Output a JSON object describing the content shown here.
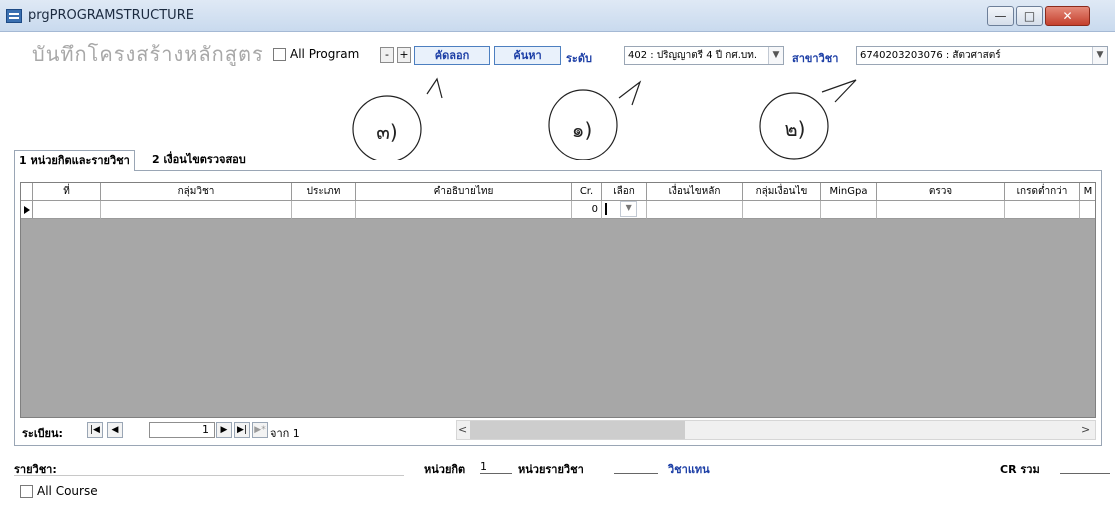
{
  "window": {
    "title": "prgPROGRAMSTRUCTURE",
    "controls": {
      "minimize": "—",
      "maximize": "□",
      "close": "✕"
    }
  },
  "toolbar": {
    "heading": "บันทึกโครงสร้างหลักสูตร",
    "all_program_label": "All Program",
    "minus_label": "-",
    "plus_label": "+",
    "copy_label": "คัดลอก",
    "search_label": "ค้นหา",
    "level_label": "ระดับ",
    "level_value": "402 : ปริญญาตรี 4 ปี กศ.บท.",
    "major_label": "สาขาวิชา",
    "major_value": "6740203203076 : สัตวศาสตร์"
  },
  "annotations": {
    "copy": "๓)",
    "level": "๑)",
    "major": "๒)"
  },
  "tabs": [
    {
      "label": "1 หน่วยกิตและรายวิชา"
    },
    {
      "label": "2 เงื่อนไขตรวจสอบ"
    }
  ],
  "grid": {
    "columns": [
      "ที่",
      "กลุ่มวิชา",
      "ประเภท",
      "คำอธิบายไทย",
      "Cr.",
      "เลือก",
      "เงื่อนไขหลัก",
      "กลุ่มเงื่อนไข",
      "MinGpa",
      "ตรวจ",
      "เกรดต่ำกว่า",
      "M"
    ],
    "row": {
      "cr": "0"
    }
  },
  "record_nav": {
    "label": "ระเบียน:",
    "current": "1",
    "of_label": "จาก 1"
  },
  "footer": {
    "subject_label": "รายวิชา:",
    "units_label": "หน่วยกิต",
    "units_value": "1",
    "course_units_label": "หน่วยรายวิชา",
    "course_type_label": "วิชาแทน",
    "credit_total_label": "CR รวม",
    "all_course_label": "All Course"
  }
}
